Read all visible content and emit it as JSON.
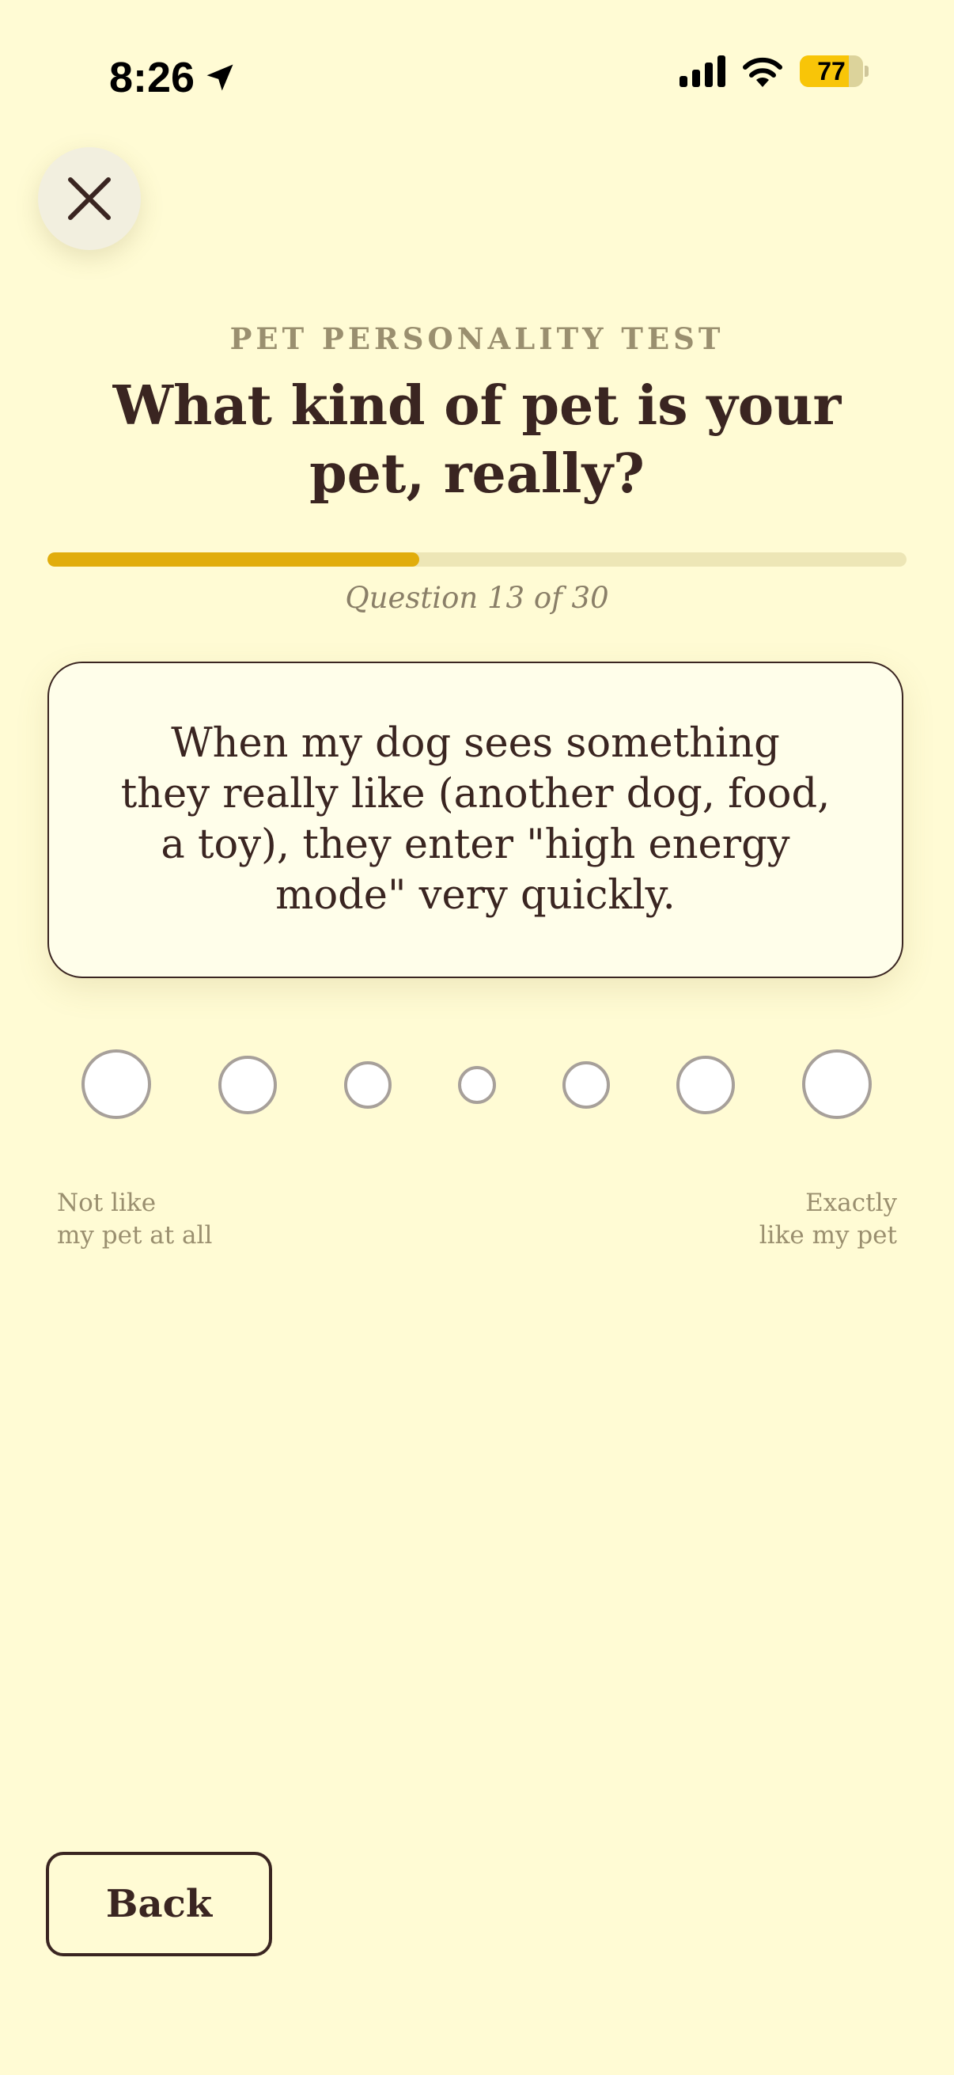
{
  "status_bar": {
    "time": "8:26",
    "battery_level": "77",
    "battery_fraction": 0.77,
    "icons": [
      "location-arrow-icon",
      "cellular-signal-icon",
      "wifi-icon",
      "battery-icon"
    ]
  },
  "header": {
    "close_icon": "close-icon",
    "eyebrow": "PET PERSONALITY TEST",
    "title": "What kind of pet is your pet, really?"
  },
  "progress": {
    "current": 13,
    "total": 30,
    "fraction": 0.433,
    "label": "Question 13 of 30"
  },
  "question": {
    "text": "When my dog sees something they really like (another dog, food, a toy), they enter \"high energy mode\" very quickly."
  },
  "scale": {
    "option_count": 7,
    "left_label_line1": "Not like",
    "left_label_line2": "my pet at all",
    "right_label_line1": "Exactly",
    "right_label_line2": "like my pet"
  },
  "footer": {
    "back_label": "Back"
  },
  "colors": {
    "background": "#fffbd4",
    "accent": "#e1ad0c",
    "text_primary": "#3a2521",
    "text_muted": "#9a8f6f",
    "battery": "#f8c508"
  }
}
